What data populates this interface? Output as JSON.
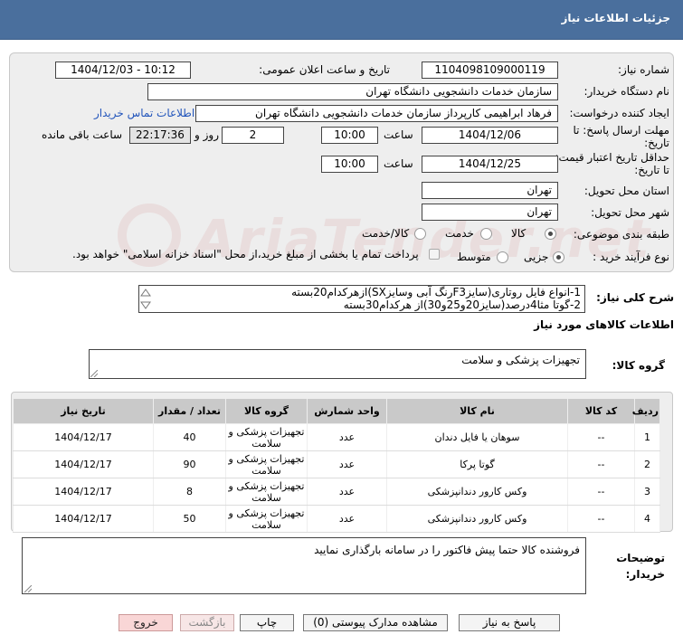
{
  "header": {
    "title": "جزئیات اطلاعات نیاز"
  },
  "watermark": {
    "text": "AriaTender.net"
  },
  "form": {
    "need_number_label": "شماره نیاز:",
    "need_number": "1104098109000119",
    "announce_label": "تاریخ و ساعت اعلان عمومی:",
    "announce_value": "1404/12/03 - 10:12",
    "buyer_org_label": "نام دستگاه خریدار:",
    "buyer_org": "سازمان خدمات دانشجویی دانشگاه تهران",
    "creator_label": "ایجاد کننده درخواست:",
    "creator": "فرهاد ابراهیمی کارپرداز سازمان خدمات دانشجویی دانشگاه تهران",
    "contact_link": "اطلاعات تماس خریدار",
    "deadline_label": "مهلت ارسال پاسخ: تا تاریخ:",
    "deadline_date": "1404/12/06",
    "time_label": "ساعت",
    "deadline_time": "10:00",
    "days_value": "2",
    "days_label": "روز و",
    "remaining_time": "22:17:36",
    "remaining_label": "ساعت باقی مانده",
    "validity_label": "حداقل تاریخ اعتبار قیمت: تا تاریخ:",
    "validity_date": "1404/12/25",
    "validity_time": "10:00",
    "province_label": "استان محل تحویل:",
    "province": "تهران",
    "city_label": "شهر محل تحویل:",
    "city": "تهران",
    "category_label": "طبقه بندی موضوعی:",
    "category_options": [
      "کالا",
      "خدمت",
      "کالا/خدمت"
    ],
    "process_label": "نوع فرآیند خرید :",
    "process_options": [
      "جزیی",
      "متوسط"
    ],
    "process_note": "پرداخت تمام یا بخشی از مبلغ خرید،از محل \"اسناد خزانه اسلامی\" خواهد بود."
  },
  "summary": {
    "label": "شرح کلی نیاز:",
    "lines": [
      "1-انواع فایل روتاری(سایزF3رنگ آبی وسایزSX)ازهرکدام20بسته",
      "2-گوتا مثا4درصد(سایز20و25و30)از هرکدام30بسته"
    ]
  },
  "goods_section_title": "اطلاعات کالاهای مورد نیاز",
  "goods_group": {
    "label": "گروه کالا:",
    "value": "تجهیزات پزشکی و سلامت"
  },
  "table": {
    "headers": [
      "ردیف",
      "کد کالا",
      "نام کالا",
      "واحد شمارش",
      "گروه کالا",
      "تعداد / مقدار",
      "تاریخ نیاز"
    ],
    "rows": [
      [
        "1",
        "--",
        "سوهان یا فایل دندان",
        "عدد",
        "تجهیزات پزشکی و سلامت",
        "40",
        "1404/12/17"
      ],
      [
        "2",
        "--",
        "گوتا پرکا",
        "عدد",
        "تجهیزات پزشکی و سلامت",
        "90",
        "1404/12/17"
      ],
      [
        "3",
        "--",
        "وکس کارور دندانپزشکی",
        "عدد",
        "تجهیزات پزشکی و سلامت",
        "8",
        "1404/12/17"
      ],
      [
        "4",
        "--",
        "وکس کارور دندانپزشکی",
        "عدد",
        "تجهیزات پزشکی و سلامت",
        "50",
        "1404/12/17"
      ]
    ]
  },
  "notes": {
    "label_line1": "توضیحات",
    "label_line2": "خریدار:",
    "value": "فروشنده کالا حتما پیش فاکتور را در سامانه بارگذاری نمایید"
  },
  "buttons": {
    "reply": "پاسخ به نیاز",
    "attachments": "مشاهده مدارک پیوستی (0)",
    "print": "چاپ",
    "back": "بازگشت",
    "exit": "خروج"
  }
}
